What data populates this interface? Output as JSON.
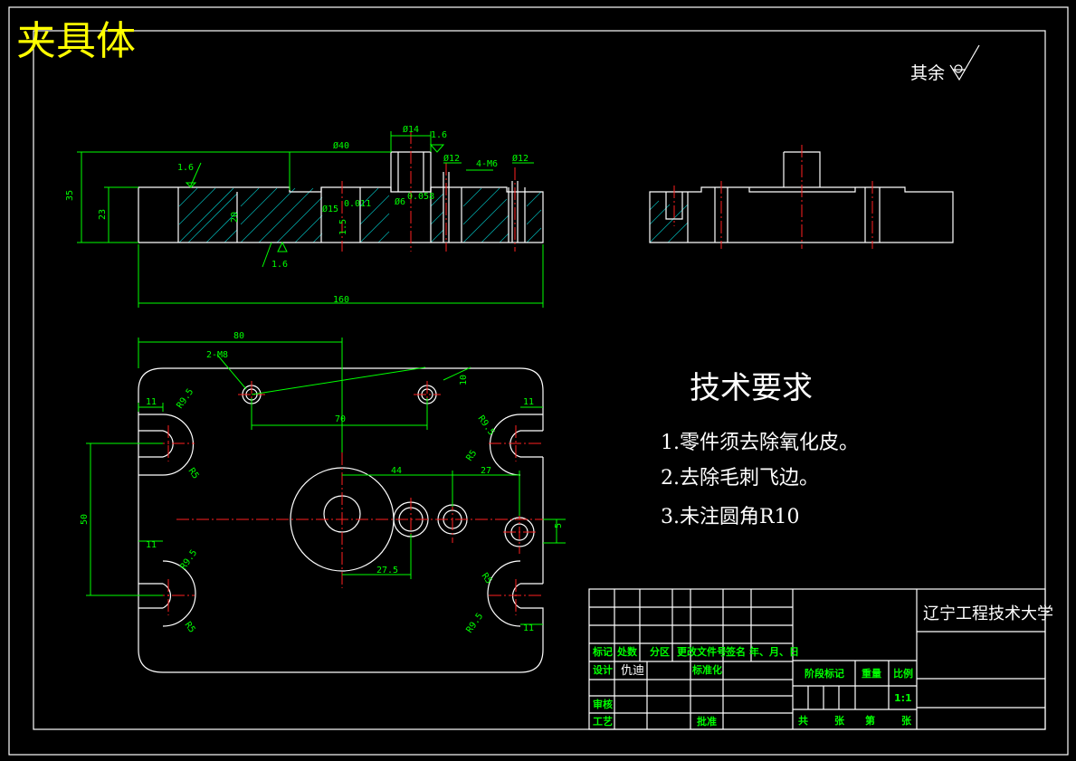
{
  "drawing_title": "夹具体",
  "roughness_note": "其余",
  "tech_requirements": {
    "heading": "技术要求",
    "items": [
      "1.零件须去除氧化皮。",
      "2.去除毛刺飞边。",
      "3.未注圆角R10"
    ]
  },
  "dimensions": {
    "top_view": [
      "35",
      "23",
      "1.6",
      "Ø40",
      "Ø14",
      "1.6",
      "Ø12",
      "4-M6",
      "Ø12",
      "Ø15",
      "0.011",
      "Ø6",
      "0.058",
      "1.5",
      "20",
      "1.6",
      "160"
    ],
    "plan_view": [
      "80",
      "2-M8",
      "10",
      "11",
      "R9.5",
      "R5",
      "70",
      "11",
      "R9.5",
      "R5",
      "50",
      "44",
      "27",
      "5",
      "11",
      "R9.5",
      "R5",
      "27.5",
      "R5",
      "R9.5",
      "11"
    ]
  },
  "title_block": {
    "school": "辽宁工程技术大学",
    "header_row": [
      "标记",
      "处数",
      "分区",
      "更改文件号",
      "签名",
      "年、月、日"
    ],
    "design_label": "设计",
    "designer": "仇迪",
    "standardize_label": "标准化",
    "review_label": "审核",
    "process_label": "工艺",
    "approve_label": "批准",
    "stage_label": "阶段标记",
    "weight_label": "重量",
    "scale_label": "比例",
    "scale_value": "1:1",
    "footer": [
      "共",
      "张",
      "第",
      "张"
    ]
  }
}
